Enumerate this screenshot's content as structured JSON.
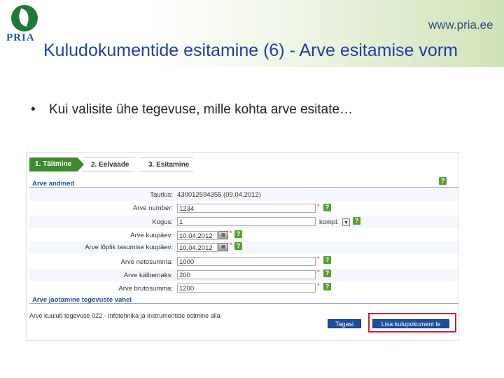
{
  "slide": {
    "logo_text": "PRIA",
    "url": "www.pria.ee",
    "title": "Kuludokumentide esitamine (6) - Arve esitamise vorm",
    "bullet": "Kui valisite ühe tegevuse, mille kohta arve esitate…"
  },
  "wizard": {
    "steps": [
      "1. Täitmine",
      "2. Eelvaade",
      "3. Esitamine"
    ]
  },
  "form": {
    "section_title": "Arve andmed",
    "help_symbol": "?",
    "tautlus_label": "Tautlus:",
    "tautlus_value": "430012594355 (09.04.2012)",
    "arve_number_label": "Arve number:",
    "arve_number_value": "1234",
    "kogus_label": "Kogus:",
    "kogus_value": "1",
    "kogus_unit": "kompl.",
    "kuupaev_label": "Arve kuupäev:",
    "kuupaev_value": "10.04.2012",
    "tasumise_label": "Arve lõplik tasumise kuupäev:",
    "tasumise_value": "10.04.2012",
    "netosumma_label": "Arve netosumma:",
    "netosumma_value": "1000",
    "kaibemaks_label": "Arve käibemaks:",
    "kaibemaks_value": "200",
    "brutosumma_label": "Arve brutosumma:",
    "brutosumma_value": "1200",
    "required_mark": "*"
  },
  "allocation": {
    "section_title": "Arve jaotamine tegevuste vahel",
    "info_text": "Arve kuulub tegevuse 022 - Infotehnika ja instrumentide ostmine alla"
  },
  "buttons": {
    "back": "Tagasi",
    "add": "Lisa kulupokument le"
  },
  "colors": {
    "title_blue": "#1f3fa8",
    "step_active": "#3d8a2f",
    "button_blue": "#1f4ea0",
    "highlight_red": "#d02030"
  }
}
